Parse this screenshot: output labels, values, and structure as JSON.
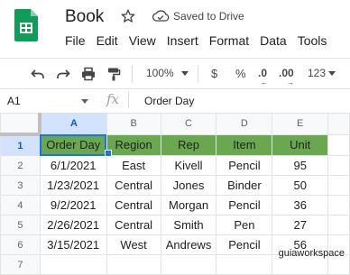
{
  "app": {
    "title": "Book",
    "save_status": "Saved to Drive"
  },
  "menu": [
    "File",
    "Edit",
    "View",
    "Insert",
    "Format",
    "Data",
    "Tools"
  ],
  "toolbar": {
    "zoom": "100%",
    "currency": "$",
    "percent": "%",
    "decrease_decimal": ".0",
    "increase_decimal": ".00",
    "more_formats": "123",
    "icons": [
      "undo-icon",
      "redo-icon",
      "print-icon",
      "paint-format-icon"
    ]
  },
  "formula_bar": {
    "cell_ref": "A1",
    "fx": "fx",
    "value": "Order Day"
  },
  "sheet": {
    "columns": [
      "A",
      "B",
      "C",
      "D",
      "E"
    ],
    "rows": [
      "1",
      "2",
      "3",
      "4",
      "5",
      "6",
      "7"
    ],
    "header": [
      "Order Day",
      "Region",
      "Rep",
      "Item",
      "Unit"
    ],
    "data": [
      [
        "6/1/2021",
        "East",
        "Kivell",
        "Pencil",
        "95"
      ],
      [
        "1/23/2021",
        "Central",
        "Jones",
        "Binder",
        "50"
      ],
      [
        "9/2/2021",
        "Central",
        "Morgan",
        "Pencil",
        "36"
      ],
      [
        "2/26/2021",
        "Central",
        "Smith",
        "Pen",
        "27"
      ],
      [
        "3/15/2021",
        "West",
        "Andrews",
        "Pencil",
        "56"
      ],
      [
        "",
        "",
        "",
        "",
        ""
      ]
    ]
  },
  "colors": {
    "header_fill": "#6aa84f",
    "selection": "#1a73e8",
    "logo": "#0f9d58"
  },
  "watermark": "guiaworkspace"
}
